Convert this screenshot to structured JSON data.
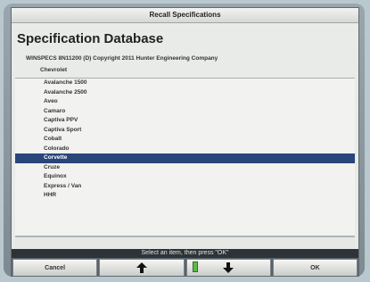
{
  "window": {
    "title": "Recall Specifications"
  },
  "heading": "Specification Database",
  "copyright": "WINSPECS 8N11200 (D) Copyright 2011 Hunter Engineering Company",
  "make": "Chevrolet",
  "models": [
    "Avalanche 1500",
    "Avalanche 2500",
    "Aveo",
    "Camaro",
    "Captiva PPV",
    "Captiva Sport",
    "Cobalt",
    "Colorado",
    "Corvette",
    "Cruze",
    "Equinox",
    "Express / Van",
    "HHR"
  ],
  "selected_index": 8,
  "status": "Select an item, then press \"OK\"",
  "buttons": {
    "cancel": "Cancel",
    "up_icon": "arrow-up-icon",
    "down_icon": "arrow-down-icon",
    "ok": "OK"
  },
  "colors": {
    "selection": "#29457a",
    "indicator": "#5dbb4a"
  }
}
